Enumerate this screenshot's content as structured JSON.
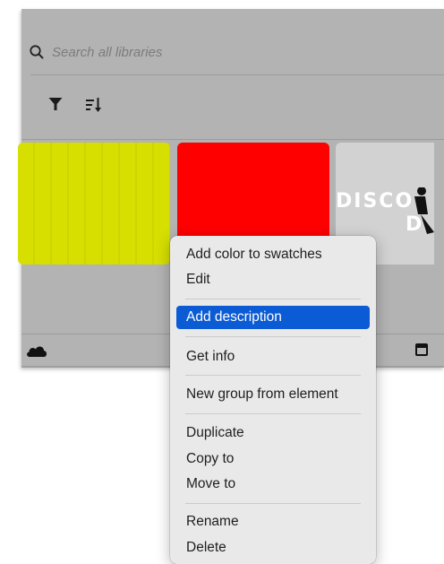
{
  "search": {
    "placeholder": "Search all libraries"
  },
  "colors": {
    "swatch_yellow": "#d6df00",
    "swatch_red": "#ff0000",
    "highlight": "#0b5bd5"
  },
  "logo_tile": {
    "line1": "DISCO",
    "line2": "D"
  },
  "context_menu": {
    "items": [
      {
        "label": "Add color to swatches"
      },
      {
        "label": "Edit"
      },
      {
        "label": "Add description",
        "highlighted": true
      },
      {
        "label": "Get info"
      },
      {
        "label": "New group from element"
      },
      {
        "label": "Duplicate"
      },
      {
        "label": "Copy to"
      },
      {
        "label": "Move to"
      },
      {
        "label": "Rename"
      },
      {
        "label": "Delete"
      }
    ]
  }
}
